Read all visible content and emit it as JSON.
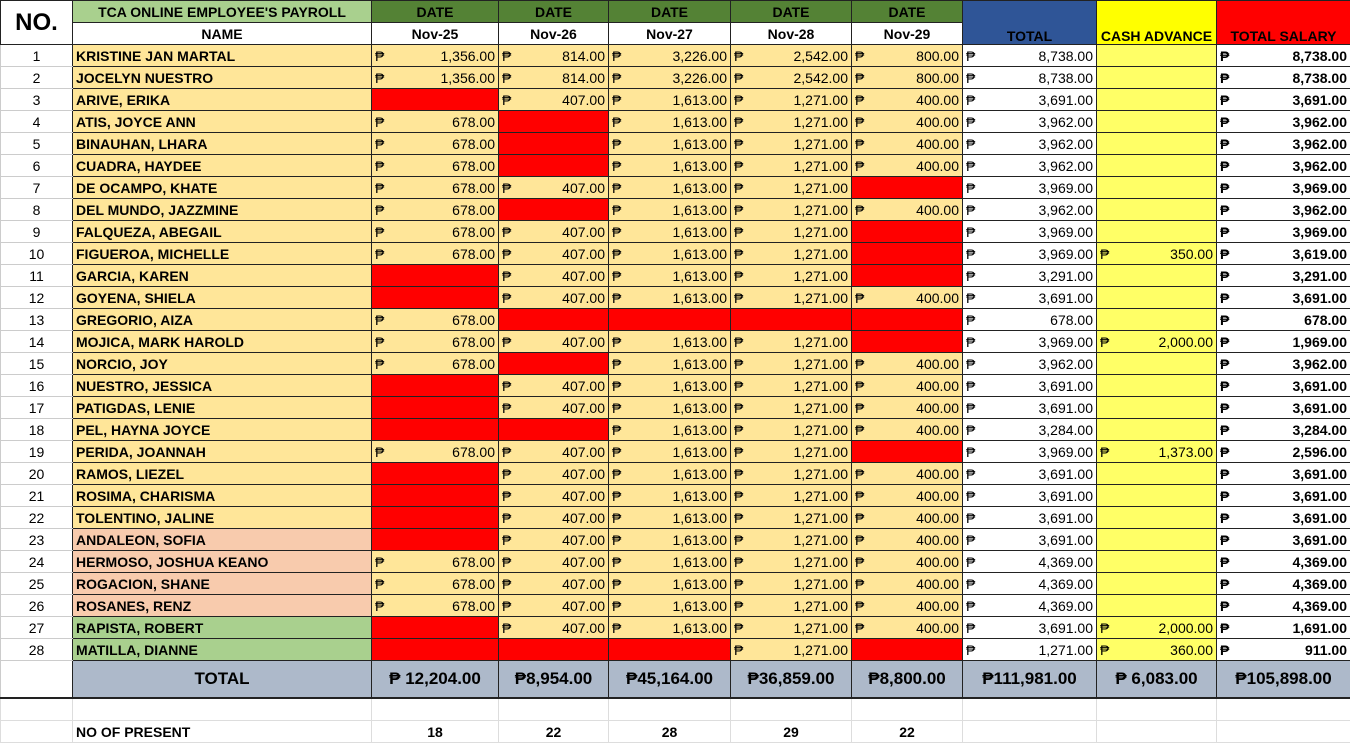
{
  "header": {
    "no": "NO.",
    "title": "TCA ONLINE EMPLOYEE'S PAYROLL",
    "name": "NAME",
    "date": "DATE",
    "dates": [
      "Nov-25",
      "Nov-26",
      "Nov-27",
      "Nov-28",
      "Nov-29"
    ],
    "total": "TOTAL",
    "cash_advance": "CASH ADVANCE",
    "total_salary": "TOTAL SALARY"
  },
  "currency": "₱",
  "colors": {
    "present": "#FFE699",
    "absent": "#FF0000",
    "date_header": "#548235",
    "total_header": "#2F5597",
    "cash_header": "#FFFF00",
    "salary_header": "#FF0000"
  },
  "rows": [
    {
      "no": "1",
      "name": "KRISTINE JAN MARTAL",
      "g": "orange",
      "d": [
        "1,356.00",
        "814.00",
        "3,226.00",
        "2,542.00",
        "800.00"
      ],
      "total": "8,738.00",
      "ca": "",
      "ts": "8,738.00"
    },
    {
      "no": "2",
      "name": "JOCELYN NUESTRO",
      "g": "orange",
      "d": [
        "1,356.00",
        "814.00",
        "3,226.00",
        "2,542.00",
        "800.00"
      ],
      "total": "8,738.00",
      "ca": "",
      "ts": "8,738.00"
    },
    {
      "no": "3",
      "name": "ARIVE, ERIKA",
      "g": "orange",
      "d": [
        null,
        "407.00",
        "1,613.00",
        "1,271.00",
        "400.00"
      ],
      "total": "3,691.00",
      "ca": "",
      "ts": "3,691.00"
    },
    {
      "no": "4",
      "name": "ATIS, JOYCE ANN",
      "g": "orange",
      "d": [
        "678.00",
        null,
        "1,613.00",
        "1,271.00",
        "400.00"
      ],
      "total": "3,962.00",
      "ca": "",
      "ts": "3,962.00"
    },
    {
      "no": "5",
      "name": "BINAUHAN, LHARA",
      "g": "orange",
      "d": [
        "678.00",
        null,
        "1,613.00",
        "1,271.00",
        "400.00"
      ],
      "total": "3,962.00",
      "ca": "",
      "ts": "3,962.00"
    },
    {
      "no": "6",
      "name": "CUADRA, HAYDEE",
      "g": "orange",
      "d": [
        "678.00",
        null,
        "1,613.00",
        "1,271.00",
        "400.00"
      ],
      "total": "3,962.00",
      "ca": "",
      "ts": "3,962.00"
    },
    {
      "no": "7",
      "name": "DE OCAMPO, KHATE",
      "g": "orange",
      "d": [
        "678.00",
        "407.00",
        "1,613.00",
        "1,271.00",
        null
      ],
      "total": "3,969.00",
      "ca": "",
      "ts": "3,969.00"
    },
    {
      "no": "8",
      "name": "DEL MUNDO, JAZZMINE",
      "g": "orange",
      "d": [
        "678.00",
        null,
        "1,613.00",
        "1,271.00",
        "400.00"
      ],
      "total": "3,962.00",
      "ca": "",
      "ts": "3,962.00"
    },
    {
      "no": "9",
      "name": "FALQUEZA, ABEGAIL",
      "g": "orange",
      "d": [
        "678.00",
        "407.00",
        "1,613.00",
        "1,271.00",
        null
      ],
      "total": "3,969.00",
      "ca": "",
      "ts": "3,969.00"
    },
    {
      "no": "10",
      "name": "FIGUEROA, MICHELLE",
      "g": "orange",
      "d": [
        "678.00",
        "407.00",
        "1,613.00",
        "1,271.00",
        null
      ],
      "total": "3,969.00",
      "ca": "350.00",
      "ts": "3,619.00"
    },
    {
      "no": "11",
      "name": "GARCIA, KAREN",
      "g": "orange",
      "d": [
        null,
        "407.00",
        "1,613.00",
        "1,271.00",
        null
      ],
      "total": "3,291.00",
      "ca": "",
      "ts": "3,291.00"
    },
    {
      "no": "12",
      "name": "GOYENA, SHIELA",
      "g": "orange",
      "d": [
        null,
        "407.00",
        "1,613.00",
        "1,271.00",
        "400.00"
      ],
      "total": "3,691.00",
      "ca": "",
      "ts": "3,691.00"
    },
    {
      "no": "13",
      "name": "GREGORIO, AIZA",
      "g": "orange",
      "d": [
        "678.00",
        null,
        null,
        null,
        null
      ],
      "total": "678.00",
      "ca": "",
      "ts": "678.00"
    },
    {
      "no": "14",
      "name": "MOJICA, MARK HAROLD",
      "g": "orange",
      "d": [
        "678.00",
        "407.00",
        "1,613.00",
        "1,271.00",
        null
      ],
      "total": "3,969.00",
      "ca": "2,000.00",
      "ts": "1,969.00"
    },
    {
      "no": "15",
      "name": "NORCIO, JOY",
      "g": "orange",
      "d": [
        "678.00",
        null,
        "1,613.00",
        "1,271.00",
        "400.00"
      ],
      "total": "3,962.00",
      "ca": "",
      "ts": "3,962.00"
    },
    {
      "no": "16",
      "name": "NUESTRO, JESSICA",
      "g": "orange",
      "d": [
        null,
        "407.00",
        "1,613.00",
        "1,271.00",
        "400.00"
      ],
      "total": "3,691.00",
      "ca": "",
      "ts": "3,691.00"
    },
    {
      "no": "17",
      "name": "PATIGDAS, LENIE",
      "g": "orange",
      "d": [
        null,
        "407.00",
        "1,613.00",
        "1,271.00",
        "400.00"
      ],
      "total": "3,691.00",
      "ca": "",
      "ts": "3,691.00"
    },
    {
      "no": "18",
      "name": "PEL, HAYNA JOYCE",
      "g": "orange",
      "d": [
        null,
        null,
        "1,613.00",
        "1,271.00",
        "400.00"
      ],
      "total": "3,284.00",
      "ca": "",
      "ts": "3,284.00"
    },
    {
      "no": "19",
      "name": "PERIDA, JOANNAH",
      "g": "orange",
      "d": [
        "678.00",
        "407.00",
        "1,613.00",
        "1,271.00",
        null
      ],
      "total": "3,969.00",
      "ca": "1,373.00",
      "ts": "2,596.00"
    },
    {
      "no": "20",
      "name": "RAMOS, LIEZEL",
      "g": "orange",
      "d": [
        null,
        "407.00",
        "1,613.00",
        "1,271.00",
        "400.00"
      ],
      "total": "3,691.00",
      "ca": "",
      "ts": "3,691.00"
    },
    {
      "no": "21",
      "name": "ROSIMA, CHARISMA",
      "g": "orange",
      "d": [
        null,
        "407.00",
        "1,613.00",
        "1,271.00",
        "400.00"
      ],
      "total": "3,691.00",
      "ca": "",
      "ts": "3,691.00"
    },
    {
      "no": "22",
      "name": "TOLENTINO, JALINE",
      "g": "orange",
      "d": [
        null,
        "407.00",
        "1,613.00",
        "1,271.00",
        "400.00"
      ],
      "total": "3,691.00",
      "ca": "",
      "ts": "3,691.00"
    },
    {
      "no": "23",
      "name": "ANDALEON, SOFIA",
      "g": "salmon",
      "d": [
        null,
        "407.00",
        "1,613.00",
        "1,271.00",
        "400.00"
      ],
      "total": "3,691.00",
      "ca": "",
      "ts": "3,691.00"
    },
    {
      "no": "24",
      "name": "HERMOSO, JOSHUA KEANO",
      "g": "salmon",
      "d": [
        "678.00",
        "407.00",
        "1,613.00",
        "1,271.00",
        "400.00"
      ],
      "total": "4,369.00",
      "ca": "",
      "ts": "4,369.00"
    },
    {
      "no": "25",
      "name": "ROGACION, SHANE",
      "g": "salmon",
      "d": [
        "678.00",
        "407.00",
        "1,613.00",
        "1,271.00",
        "400.00"
      ],
      "total": "4,369.00",
      "ca": "",
      "ts": "4,369.00"
    },
    {
      "no": "26",
      "name": "ROSANES, RENZ",
      "g": "salmon",
      "d": [
        "678.00",
        "407.00",
        "1,613.00",
        "1,271.00",
        "400.00"
      ],
      "total": "4,369.00",
      "ca": "",
      "ts": "4,369.00"
    },
    {
      "no": "27",
      "name": "RAPISTA, ROBERT",
      "g": "green",
      "d": [
        null,
        "407.00",
        "1,613.00",
        "1,271.00",
        "400.00"
      ],
      "total": "3,691.00",
      "ca": "2,000.00",
      "ts": "1,691.00"
    },
    {
      "no": "28",
      "name": "MATILLA, DIANNE",
      "g": "green",
      "d": [
        null,
        null,
        null,
        "1,271.00",
        null
      ],
      "total": "1,271.00",
      "ca": "360.00",
      "ts": "911.00"
    }
  ],
  "totals": {
    "label": "TOTAL",
    "values": [
      "₱ 12,204.00",
      "₱8,954.00",
      "₱45,164.00",
      "₱36,859.00",
      "₱8,800.00",
      "₱111,981.00",
      "₱  6,083.00",
      "₱105,898.00"
    ]
  },
  "present": {
    "label": "NO OF PRESENT",
    "values": [
      "18",
      "22",
      "28",
      "29",
      "22"
    ]
  }
}
